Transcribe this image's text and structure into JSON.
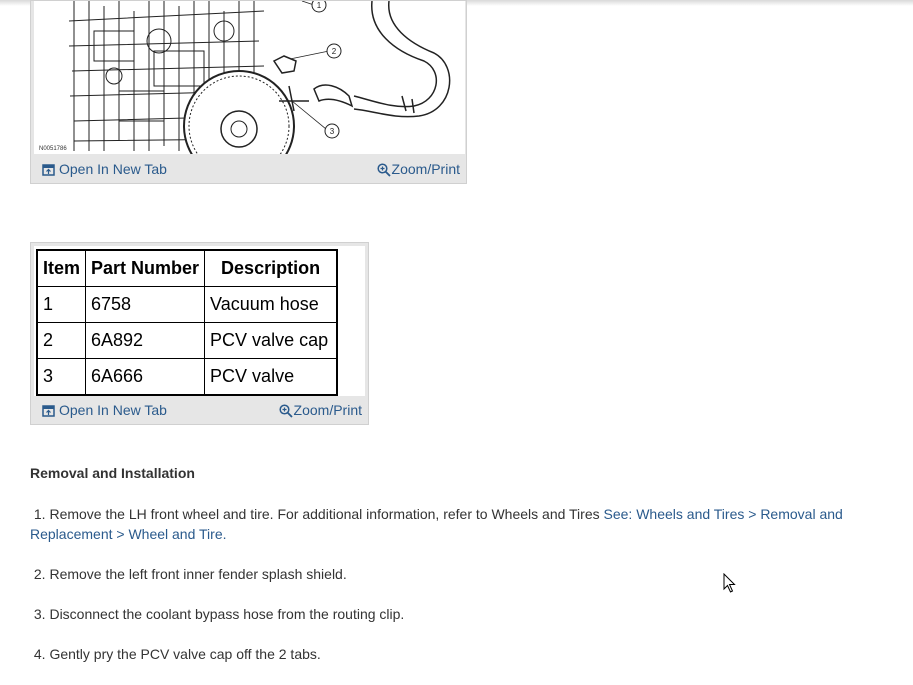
{
  "figure": {
    "code": "N0051786",
    "callouts": [
      "1",
      "2",
      "3"
    ],
    "toolbar": {
      "open_label": "Open In New Tab",
      "zoom_label": "Zoom/Print"
    }
  },
  "parts_table": {
    "headers": [
      "Item",
      "Part Number",
      "Description"
    ],
    "rows": [
      [
        "1",
        "6758",
        "Vacuum hose"
      ],
      [
        "2",
        "6A892",
        "PCV valve cap"
      ],
      [
        "3",
        "6A666",
        "PCV valve"
      ]
    ],
    "toolbar": {
      "open_label": "Open In New Tab",
      "zoom_label": "Zoom/Print"
    }
  },
  "section": {
    "title": "Removal and Installation",
    "steps": [
      {
        "text": "1. Remove the LH front wheel and tire. For additional information, refer to Wheels and Tires ",
        "link": "See: Wheels and Tires > Removal and Replacement > Wheel and Tire",
        "after": "."
      },
      {
        "text": "2. Remove the left front inner fender splash shield."
      },
      {
        "text": "3. Disconnect the coolant bypass hose from the routing clip."
      },
      {
        "text": "4. Gently pry the PCV valve cap off the 2 tabs."
      }
    ]
  },
  "colors": {
    "link": "#2a5a8c",
    "box_bg": "#e6e6e6",
    "text": "#333333"
  },
  "icons": {
    "open": "open-new-tab-icon",
    "zoom": "zoom-icon",
    "cursor": "mouse-pointer-icon"
  }
}
